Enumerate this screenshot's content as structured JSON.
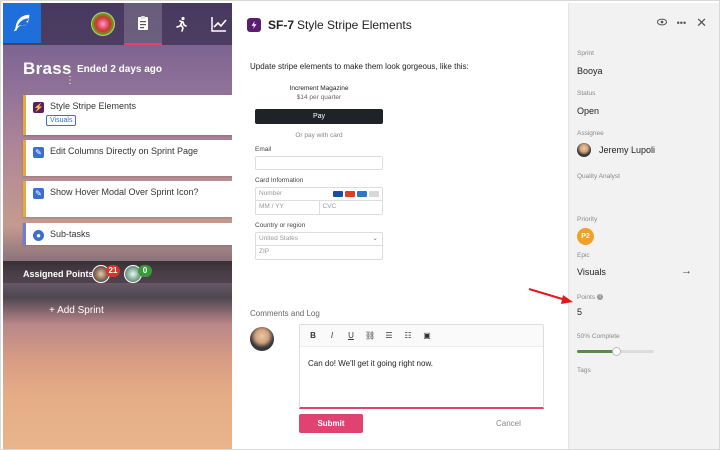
{
  "left": {
    "sprint_name": "Brass",
    "sprint_ended": "Ended 2 days ago",
    "cards": [
      {
        "label": "Style Stripe Elements",
        "tag": "Visuals",
        "icon": "bolt-icon"
      },
      {
        "label": "Edit Columns Directly on Sprint Page",
        "icon": "pencil-icon"
      },
      {
        "label": "Show Hover Modal Over Sprint Icon?",
        "icon": "pencil-icon"
      },
      {
        "label": "Sub-tasks",
        "icon": "subtask-icon"
      }
    ],
    "assigned_label": "Assigned Points:",
    "assigned_points": [
      "21",
      "0"
    ],
    "add_sprint": "+ Add Sprint"
  },
  "main": {
    "id": "SF-7",
    "title": "Style Stripe Elements",
    "description": "Update stripe elements to make them look gorgeous, like this:",
    "stripe": {
      "merchant": "Increment Magazine",
      "price": "$14 per quarter",
      "apple_pay": "Pay",
      "or_pay": "Or pay with card",
      "email_label": "Email",
      "card_label": "Card Information",
      "card_placeholder": "Number",
      "exp_placeholder": "MM / YY",
      "cvc_placeholder": "CVC",
      "country_label": "Country or region",
      "country_value": "United States",
      "zip_placeholder": "ZIP"
    },
    "comments_label": "Comments and Log",
    "comment_text": "Can do!  We'll get it going right now.",
    "submit": "Submit",
    "cancel": "Cancel"
  },
  "sidebar": {
    "sprint_label": "Sprint",
    "sprint_value": "Booya",
    "status_label": "Status",
    "status_value": "Open",
    "assignee_label": "Assignee",
    "assignee_value": "Jeremy Lupoli",
    "qa_label": "Quality Analyst",
    "priority_label": "Priority",
    "priority_value": "P2",
    "epic_label": "Epic",
    "epic_value": "Visuals",
    "points_label": "Points",
    "points_value": "5",
    "complete_label": "50% Complete",
    "complete_fraction": 0.5,
    "tags_label": "Tags"
  },
  "colors": {
    "accent": "#e0436f",
    "brand": "#1e6fd9",
    "priority": "#f0a12b",
    "card_border": "#e6a93a"
  }
}
